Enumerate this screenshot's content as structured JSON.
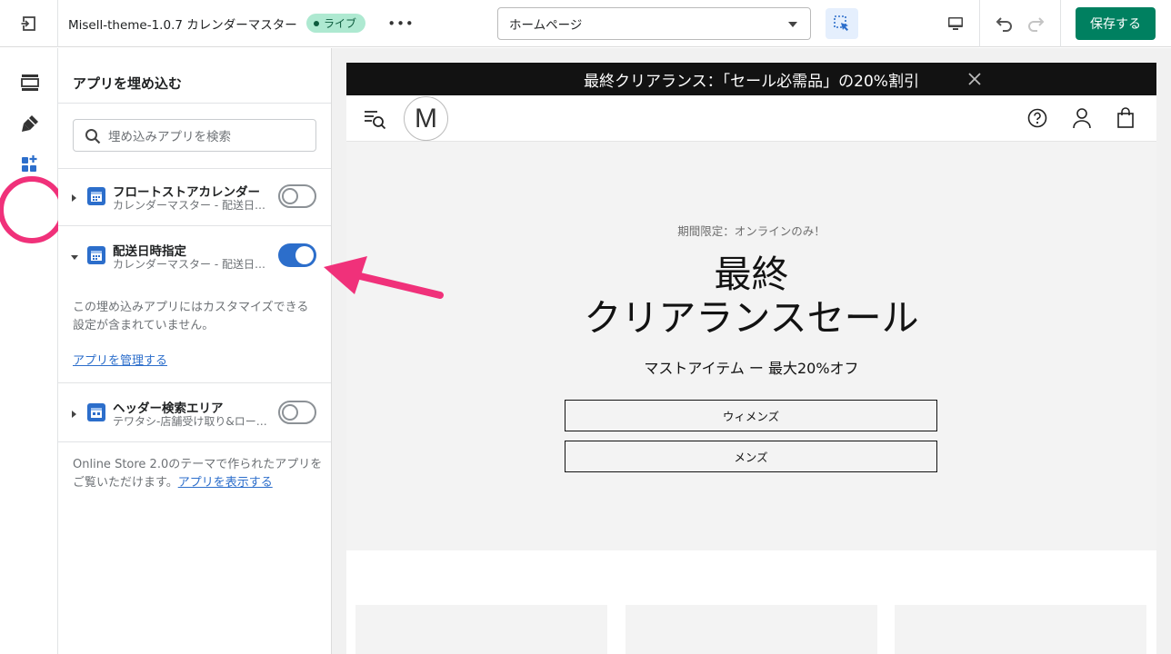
{
  "topbar": {
    "theme_title": "Misell-theme-1.0.7 カレンダーマスター",
    "status_badge": "ライブ",
    "more_label": "•••",
    "page_selector_value": "ホームページ",
    "save_label": "保存する"
  },
  "rail": {
    "items": [
      "sections-icon",
      "theme-settings-icon",
      "app-embeds-icon"
    ]
  },
  "panel": {
    "title": "アプリを埋め込む",
    "search_placeholder": "埋め込みアプリを検索",
    "apps": [
      {
        "name": "フロートストアカレンダー",
        "subtitle": "カレンダーマスター - 配送日時…",
        "enabled": false,
        "expanded": false
      },
      {
        "name": "配送日時指定",
        "subtitle": "カレンダーマスター - 配送日時…",
        "enabled": true,
        "expanded": true
      },
      {
        "name": "ヘッダー検索エリア",
        "subtitle": "テワタシ-店舗受け取り&ロー…",
        "enabled": false,
        "expanded": false
      }
    ],
    "no_settings_text": "この埋め込みアプリにはカスタマイズできる設定が含まれていません。",
    "manage_link": "アプリを管理する",
    "footer_text": "Online Store 2.0のテーマで作られたアプリをご覧いただけます。",
    "footer_link": "アプリを表示する"
  },
  "preview": {
    "announcement": "最終クリアランス：「セール必需品」の20%割引",
    "logo_letter": "M",
    "hero": {
      "eyebrow": "期間限定：オンラインのみ！",
      "title_line1": "最終",
      "title_line2": "クリアランスセール",
      "subtitle": "マストアイテム ー 最大20%オフ",
      "button_women": "ウィメンズ",
      "button_men": "メンズ"
    }
  },
  "colors": {
    "accent_blue": "#2c6ecb",
    "save_green": "#008060",
    "highlight_pink": "#f0317a",
    "live_badge": "#aee9d1",
    "announcement_bg": "#121212"
  }
}
